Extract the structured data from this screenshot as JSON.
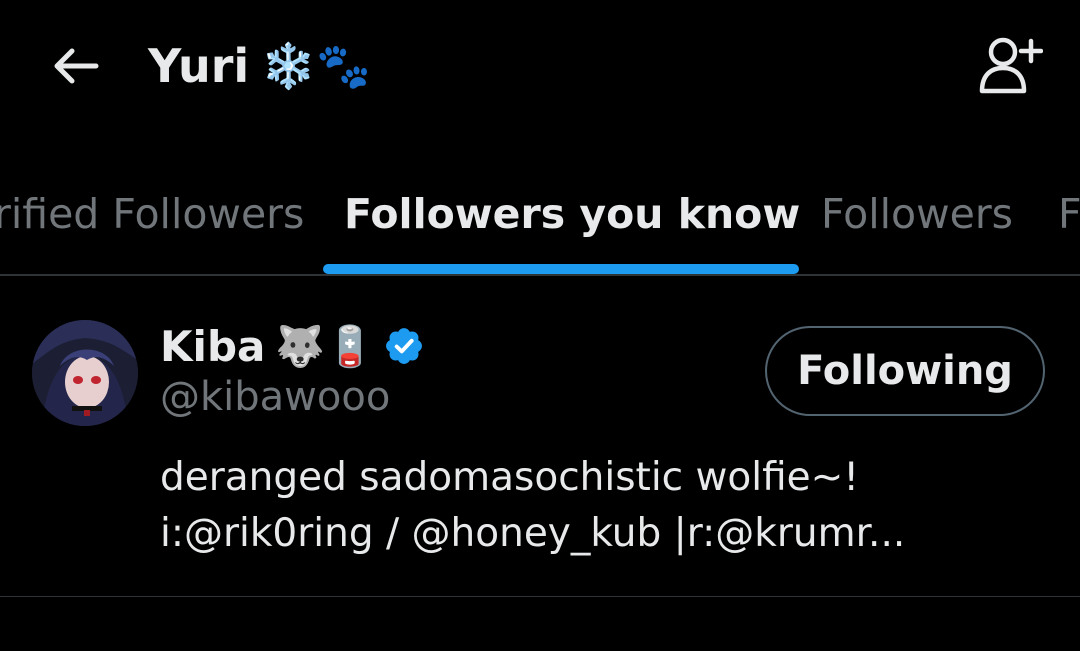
{
  "header": {
    "title": "Yuri",
    "title_emoji": "❄️🐾",
    "back_icon": "arrow-left-icon",
    "add_user_icon": "add-user-icon"
  },
  "tabs": [
    {
      "label": "rified Followers"
    },
    {
      "label": "Followers you know"
    },
    {
      "label": "Followers"
    },
    {
      "label": "F"
    }
  ],
  "active_tab": "Followers you know",
  "users": [
    {
      "name": "Kiba",
      "name_emoji": "🐺🪫",
      "verified": true,
      "handle": "@kibawooo",
      "bio_lines": [
        "deranged sadomasochistic wolfie~!",
        "i:@rik0ring / @honey_kub |r:@krumr..."
      ],
      "button_label": "Following"
    }
  ],
  "colors": {
    "background": "#000000",
    "primary_text": "#e7e9ea",
    "secondary_text": "#71767b",
    "accent": "#1d9bf0",
    "divider": "#2f3336",
    "button_border": "#536471"
  }
}
